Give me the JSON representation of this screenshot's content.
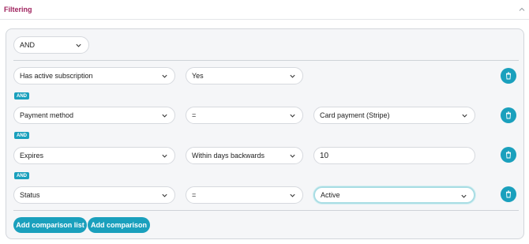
{
  "header": {
    "title": "Filtering",
    "collapse_icon": "chevron-up-icon"
  },
  "panel": {
    "group_operator": "AND",
    "rows": [
      {
        "field": "Has active subscription",
        "operator": "Yes",
        "value": ""
      },
      {
        "connector": "AND",
        "field": "Payment method",
        "operator": "=",
        "value": "Card payment (Stripe)"
      },
      {
        "connector": "AND",
        "field": "Expires",
        "operator": "Within days backwards",
        "value": "10"
      },
      {
        "connector": "AND",
        "field": "Status",
        "operator": "=",
        "value": "Active"
      }
    ],
    "buttons": {
      "add_comparison_list": "Add comparison list",
      "add_comparison": "Add comparison"
    }
  },
  "colors": {
    "accent": "#1aa0bd",
    "title": "#a0245f",
    "focus_ring": "#a9dde4"
  },
  "icons": {
    "dropdown": "chevron-down-icon",
    "delete": "trash-icon"
  }
}
